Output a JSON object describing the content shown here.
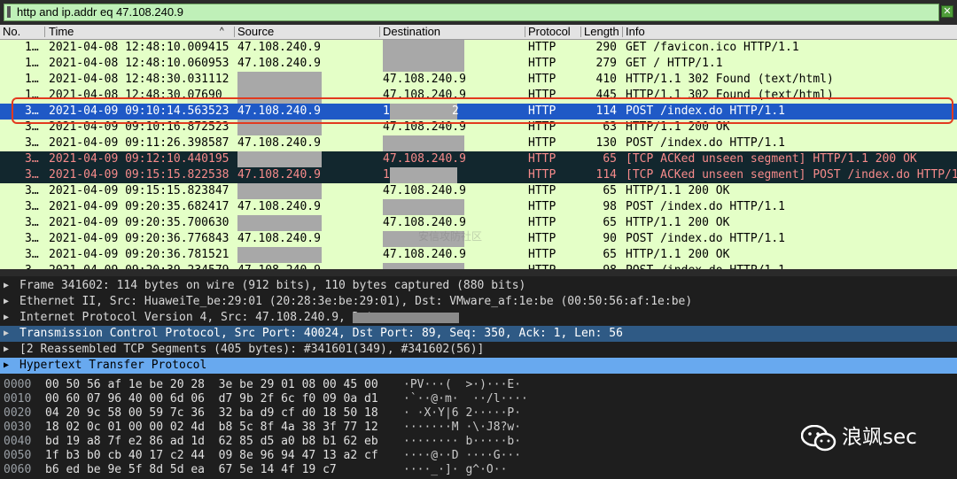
{
  "filter": {
    "value": "http and ip.addr eq 47.108.240.9",
    "clear_icon": "✕"
  },
  "columns": [
    "No.",
    "Time",
    "Source",
    "Destination",
    "Protocol",
    "Length",
    "Info"
  ],
  "packets": [
    {
      "no": "1…",
      "time": "2021-04-08 12:48:10.009415",
      "src": "47.108.240.9",
      "dst": "",
      "proto": "HTTP",
      "len": "290",
      "info": "GET /favicon.ico HTTP/1.1",
      "style": "green"
    },
    {
      "no": "1…",
      "time": "2021-04-08 12:48:10.060953",
      "src": "47.108.240.9",
      "dst": "",
      "proto": "HTTP",
      "len": "279",
      "info": "GET / HTTP/1.1",
      "style": "green"
    },
    {
      "no": "1…",
      "time": "2021-04-08 12:48:30.031112",
      "src": "",
      "dst": "47.108.240.9",
      "proto": "HTTP",
      "len": "410",
      "info": "HTTP/1.1 302 Found  (text/html)",
      "style": "green"
    },
    {
      "no": "1…",
      "time": "2021-04-08 12:48:30.07690",
      "src": "",
      "dst": "47.108.240.9",
      "proto": "HTTP",
      "len": "445",
      "info": "HTTP/1.1 302 Found  (text/html)",
      "style": "green"
    },
    {
      "no": "3…",
      "time": "2021-04-09 09:10:14.563523",
      "src": "47.108.240.9",
      "dst": "1",
      "dst_tail": "2",
      "proto": "HTTP",
      "len": "114",
      "info": "POST /index.do HTTP/1.1",
      "style": "selected"
    },
    {
      "no": "3…",
      "time": "2021-04-09 09:10:16.872523",
      "src": "",
      "dst": "47.108.240.9",
      "proto": "HTTP",
      "len": "63",
      "info": "HTTP/1.1 200 OK",
      "style": "green"
    },
    {
      "no": "3…",
      "time": "2021-04-09 09:11:26.398587",
      "src": "47.108.240.9",
      "dst": "",
      "proto": "HTTP",
      "len": "130",
      "info": "POST /index.do HTTP/1.1",
      "style": "green"
    },
    {
      "no": "3…",
      "time": "2021-04-09 09:12:10.440195",
      "src": "",
      "dst": "47.108.240.9",
      "proto": "HTTP",
      "len": "65",
      "info": "[TCP ACKed unseen segment] HTTP/1.1 200 OK",
      "style": "black"
    },
    {
      "no": "3…",
      "time": "2021-04-09 09:15:15.822538",
      "src": "47.108.240.9",
      "dst": "1",
      "proto": "HTTP",
      "len": "114",
      "info": "[TCP ACKed unseen segment] POST /index.do HTTP/1",
      "style": "black"
    },
    {
      "no": "3…",
      "time": "2021-04-09 09:15:15.823847",
      "src": "",
      "dst": "47.108.240.9",
      "proto": "HTTP",
      "len": "65",
      "info": "HTTP/1.1 200 OK",
      "style": "green"
    },
    {
      "no": "3…",
      "time": "2021-04-09 09:20:35.682417",
      "src": "47.108.240.9",
      "dst": "",
      "proto": "HTTP",
      "len": "98",
      "info": "POST /index.do HTTP/1.1",
      "style": "green"
    },
    {
      "no": "3…",
      "time": "2021-04-09 09:20:35.700630",
      "src": "",
      "dst": "47.108.240.9",
      "proto": "HTTP",
      "len": "65",
      "info": "HTTP/1.1 200 OK",
      "style": "green"
    },
    {
      "no": "3…",
      "time": "2021-04-09 09:20:36.776843",
      "src": "47.108.240.9",
      "dst": "",
      "proto": "HTTP",
      "len": "90",
      "info": "POST /index.do HTTP/1.1",
      "style": "green"
    },
    {
      "no": "3…",
      "time": "2021-04-09 09:20:36.781521",
      "src": "",
      "dst": "47.108.240.9",
      "proto": "HTTP",
      "len": "65",
      "info": "HTTP/1.1 200 OK",
      "style": "green"
    },
    {
      "no": "3…",
      "time": "2021-04-09 09:20:39.234579",
      "src": "47.108.240.9",
      "dst": "",
      "proto": "HTTP",
      "len": "98",
      "info": "POST /index.do HTTP/1.1",
      "style": "green"
    }
  ],
  "details": [
    {
      "text": "Frame 341602: 114 bytes on wire (912 bits), 110 bytes captured (880 bits)",
      "style": ""
    },
    {
      "text": "Ethernet II, Src: HuaweiTe_be:29:01 (20:28:3e:be:29:01), Dst: VMware_af:1e:be (00:50:56:af:1e:be)",
      "style": ""
    },
    {
      "text": "Internet Protocol Version 4, Src: 47.108.240.9, Dst: ",
      "style": ""
    },
    {
      "text": "Transmission Control Protocol, Src Port: 40024, Dst Port: 89, Seq: 350, Ack: 1, Len: 56",
      "style": "hl1"
    },
    {
      "text": "[2 Reassembled TCP Segments (405 bytes): #341601(349), #341602(56)]",
      "style": ""
    },
    {
      "text": "Hypertext Transfer Protocol",
      "style": "hl2"
    }
  ],
  "hex": [
    {
      "off": "0000",
      "hex": "00 50 56 af 1e be 20 28  3e be 29 01 08 00 45 00",
      "asc": "·PV···(  >·)···E·"
    },
    {
      "off": "0010",
      "hex": "00 60 07 96 40 00 6d 06  d7 9b 2f 6c f0 09 0a d1",
      "asc": "·`··@·m·  ··/l····"
    },
    {
      "off": "0020",
      "hex": "04 20 9c 58 00 59 7c 36  32 ba d9 cf d0 18 50 18",
      "asc": "· ·X·Y|6 2·····P·"
    },
    {
      "off": "0030",
      "hex": "18 02 0c 01 00 00 02 4d  b8 5c 8f 4a 38 3f 77 12",
      "asc": "·······M ·\\·J8?w·"
    },
    {
      "off": "0040",
      "hex": "bd 19 a8 7f e2 86 ad 1d  62 85 d5 a0 b8 b1 62 eb",
      "asc": "········ b·····b·"
    },
    {
      "off": "0050",
      "hex": "1f b3 b0 cb 40 17 c2 44  09 8e 96 94 47 13 a2 cf",
      "asc": "····@··D ····G···"
    },
    {
      "off": "0060",
      "hex": "b6 ed be 9e 5f 8d 5d ea  67 5e 14 4f 19 c7",
      "asc": "····_·]· g^·O··"
    }
  ],
  "watermark": "安信攻防社区",
  "logo": {
    "text": "浪飒sec",
    "icon": "wechat-icon"
  },
  "colors": {
    "selected": "#1f59c6",
    "green": "#e4ffc7",
    "black_row": "#12272e",
    "highlight_box": "#e23a1f"
  }
}
